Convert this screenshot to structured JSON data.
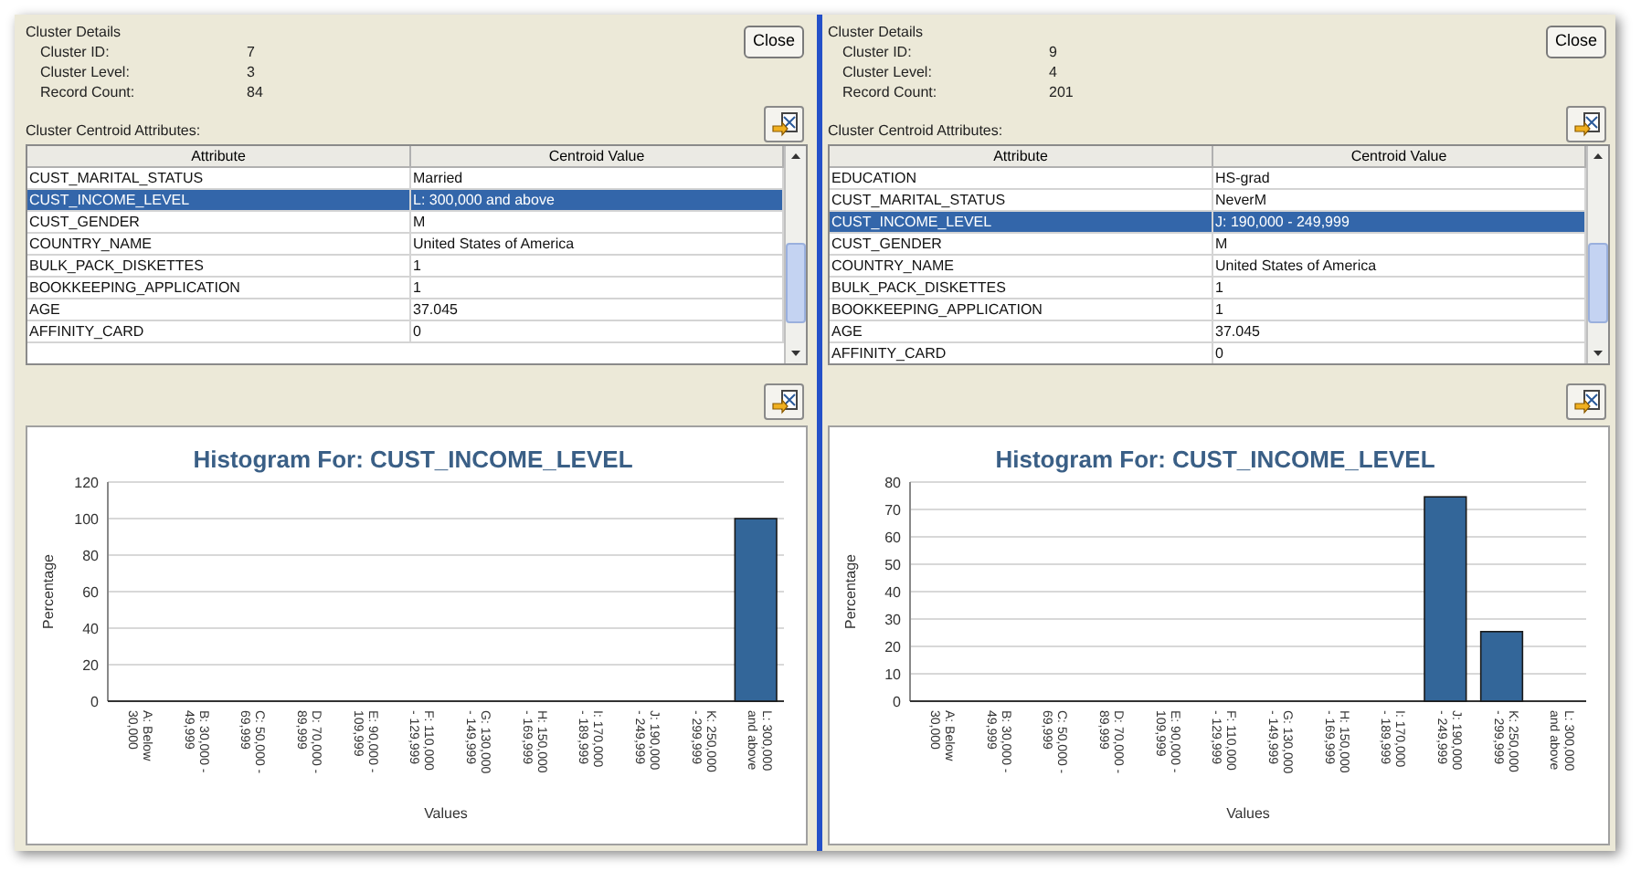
{
  "panels": [
    {
      "selected": false,
      "details": {
        "title": "Cluster Details",
        "fields": [
          {
            "label": "Cluster ID:",
            "value": "7"
          },
          {
            "label": "Cluster Level:",
            "value": "3"
          },
          {
            "label": "Record Count:",
            "value": "84"
          }
        ]
      },
      "close_button": "Close",
      "table": {
        "label": "Cluster Centroid Attributes:",
        "columns": [
          "Attribute",
          "Centroid Value"
        ],
        "rows": [
          {
            "cells": [
              "CUST_MARITAL_STATUS",
              "Married"
            ],
            "selected": false
          },
          {
            "cells": [
              "CUST_INCOME_LEVEL",
              "L: 300,000 and above"
            ],
            "selected": true
          },
          {
            "cells": [
              "CUST_GENDER",
              "M"
            ],
            "selected": false
          },
          {
            "cells": [
              "COUNTRY_NAME",
              "United States of America"
            ],
            "selected": false
          },
          {
            "cells": [
              "BULK_PACK_DISKETTES",
              "1"
            ],
            "selected": false
          },
          {
            "cells": [
              "BOOKKEEPING_APPLICATION",
              "1"
            ],
            "selected": false
          },
          {
            "cells": [
              "AGE",
              "37.045"
            ],
            "selected": false
          },
          {
            "cells": [
              "AFFINITY_CARD",
              "0"
            ],
            "selected": false
          }
        ]
      },
      "chart_data": {
        "type": "bar",
        "title": "Histogram For: CUST_INCOME_LEVEL",
        "xlabel": "Values",
        "ylabel": "Percentage",
        "categories": [
          "A: Below 30,000",
          "B: 30,000 - 49,999",
          "C: 50,000 - 69,999",
          "D: 70,000 - 89,999",
          "E: 90,000 - 109,999",
          "F: 110,000 - 129,999",
          "G: 130,000 - 149,999",
          "H: 150,000 - 169,999",
          "I: 170,000 - 189,999",
          "J: 190,000 - 249,999",
          "K: 250,000 - 299,999",
          "L: 300,000 and above"
        ],
        "series": [
          {
            "color": "#336699",
            "values": [
              0,
              0,
              0,
              0,
              0,
              0,
              0,
              0,
              0,
              0,
              0,
              100
            ]
          }
        ],
        "ylim": [
          0,
          120
        ],
        "grid": true,
        "yticks": [
          0,
          20,
          40,
          60,
          80,
          100,
          120
        ]
      }
    },
    {
      "selected": true,
      "details": {
        "title": "Cluster Details",
        "fields": [
          {
            "label": "Cluster ID:",
            "value": "9"
          },
          {
            "label": "Cluster Level:",
            "value": "4"
          },
          {
            "label": "Record Count:",
            "value": "201"
          }
        ]
      },
      "close_button": "Close",
      "table": {
        "label": "Cluster Centroid Attributes:",
        "columns": [
          "Attribute",
          "Centroid Value"
        ],
        "rows": [
          {
            "cells": [
              "EDUCATION",
              "HS-grad"
            ],
            "selected": false
          },
          {
            "cells": [
              "CUST_MARITAL_STATUS",
              "NeverM"
            ],
            "selected": false
          },
          {
            "cells": [
              "CUST_INCOME_LEVEL",
              "J: 190,000 - 249,999"
            ],
            "selected": true
          },
          {
            "cells": [
              "CUST_GENDER",
              "M"
            ],
            "selected": false
          },
          {
            "cells": [
              "COUNTRY_NAME",
              "United States of America"
            ],
            "selected": false
          },
          {
            "cells": [
              "BULK_PACK_DISKETTES",
              "1"
            ],
            "selected": false
          },
          {
            "cells": [
              "BOOKKEEPING_APPLICATION",
              "1"
            ],
            "selected": false
          },
          {
            "cells": [
              "AGE",
              "37.045"
            ],
            "selected": false
          },
          {
            "cells": [
              "AFFINITY_CARD",
              "0"
            ],
            "selected": false
          }
        ]
      },
      "chart_data": {
        "type": "bar",
        "title": "Histogram For: CUST_INCOME_LEVEL",
        "xlabel": "Values",
        "ylabel": "Percentage",
        "categories": [
          "A: Below 30,000",
          "B: 30,000 - 49,999",
          "C: 50,000 - 69,999",
          "D: 70,000 - 89,999",
          "E: 90,000 - 109,999",
          "F: 110,000 - 129,999",
          "G: 130,000 - 149,999",
          "H: 150,000 - 169,999",
          "I: 170,000 - 189,999",
          "J: 190,000 - 249,999",
          "K: 250,000 - 299,999",
          "L: 300,000 and above"
        ],
        "series": [
          {
            "color": "#336699",
            "values": [
              0,
              0,
              0,
              0,
              0,
              0,
              0,
              0,
              0,
              74.6,
              25.4,
              0
            ]
          }
        ],
        "ylim": [
          0,
          80
        ],
        "grid": true,
        "yticks": [
          0,
          10,
          20,
          30,
          40,
          50,
          60,
          70,
          80
        ]
      }
    }
  ]
}
